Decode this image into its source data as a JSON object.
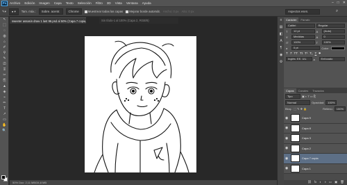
{
  "app": {
    "logo": "Ps"
  },
  "menu": [
    "Archivo",
    "Edición",
    "Imagen",
    "Capa",
    "Texto",
    "Selección",
    "Filtro",
    "3D",
    "Vista",
    "Ventana",
    "Ayuda"
  ],
  "window_controls": [
    "–",
    "□",
    "✕"
  ],
  "options": {
    "size_label": "Tam. máx.:",
    "tool_preset": "Sobre. acentr.",
    "sample": "Chrome",
    "sample_all_label": "Muestrear todas las capas",
    "enhance_label": "Mejorar borde automát.",
    "angle_label": "Ajustar",
    "workspace_label": "Aspectos esen.",
    "width_label": "Ancho: 0 px",
    "height_label": "Alto: 0 px"
  },
  "doc": {
    "tab_active": "sweeter assasin draw 1 last 96.psd al 50% (Capa 7 copia, RGB/8#)",
    "tab_inactive": "Sin título-1 al 100% (Capa 2, RGB/8)",
    "status": "50%   Doc: 2,11 MB/34,8 MB"
  },
  "tools": [
    "↖",
    "⬚",
    "◌",
    "◍",
    "⌂",
    "✐",
    "⚲",
    "✎",
    "⎚",
    "⍐",
    "✂",
    "⎘",
    "▲",
    "◈",
    "⌁",
    "✏",
    "T",
    "↗",
    "▭",
    "✋",
    "🔍"
  ],
  "dock_icons": [
    "≡",
    "▤",
    "◧",
    "A",
    "¶",
    "◉",
    "⚙"
  ],
  "character_panel": {
    "tabs": [
      "Carácter",
      "Párrafo"
    ],
    "font_family": "Calibri",
    "font_style": "Regular",
    "size": "12 pt",
    "leading": "(Auto)",
    "kerning": "Medidas",
    "tracking": "0",
    "vscale": "100%",
    "hscale": "100%",
    "baseline": "0 pt",
    "color_label": "Color:",
    "lang": "Inglés: EE. UU.",
    "aa": "Enfocado"
  },
  "layers_panel": {
    "tabs": [
      "Capas",
      "Canales",
      "Trazados"
    ],
    "filter_label": "Tipo",
    "blend_mode": "Normal",
    "opacity_label": "Opacidad:",
    "opacity": "100%",
    "lock_label": "Bloq.:",
    "fill_label": "Relleno:",
    "fill": "100%",
    "layers": [
      {
        "name": "Capa 9",
        "selected": false
      },
      {
        "name": "Capa 8",
        "selected": false
      },
      {
        "name": "Capa 3",
        "selected": false
      },
      {
        "name": "Capa 2",
        "selected": false
      },
      {
        "name": "Capa 7 copia",
        "selected": true
      },
      {
        "name": "Capa 1",
        "selected": false
      },
      {
        "name": "Ojetes",
        "selected": false
      },
      {
        "name": "Fondo",
        "selected": false
      }
    ],
    "footer_icons": [
      "⛓",
      "fx",
      "◐",
      "◑",
      "▭",
      "▣",
      "🗑"
    ]
  },
  "colors": {
    "accent": "#5d6f86",
    "canvas": "#ffffff",
    "bg": "#282828"
  }
}
